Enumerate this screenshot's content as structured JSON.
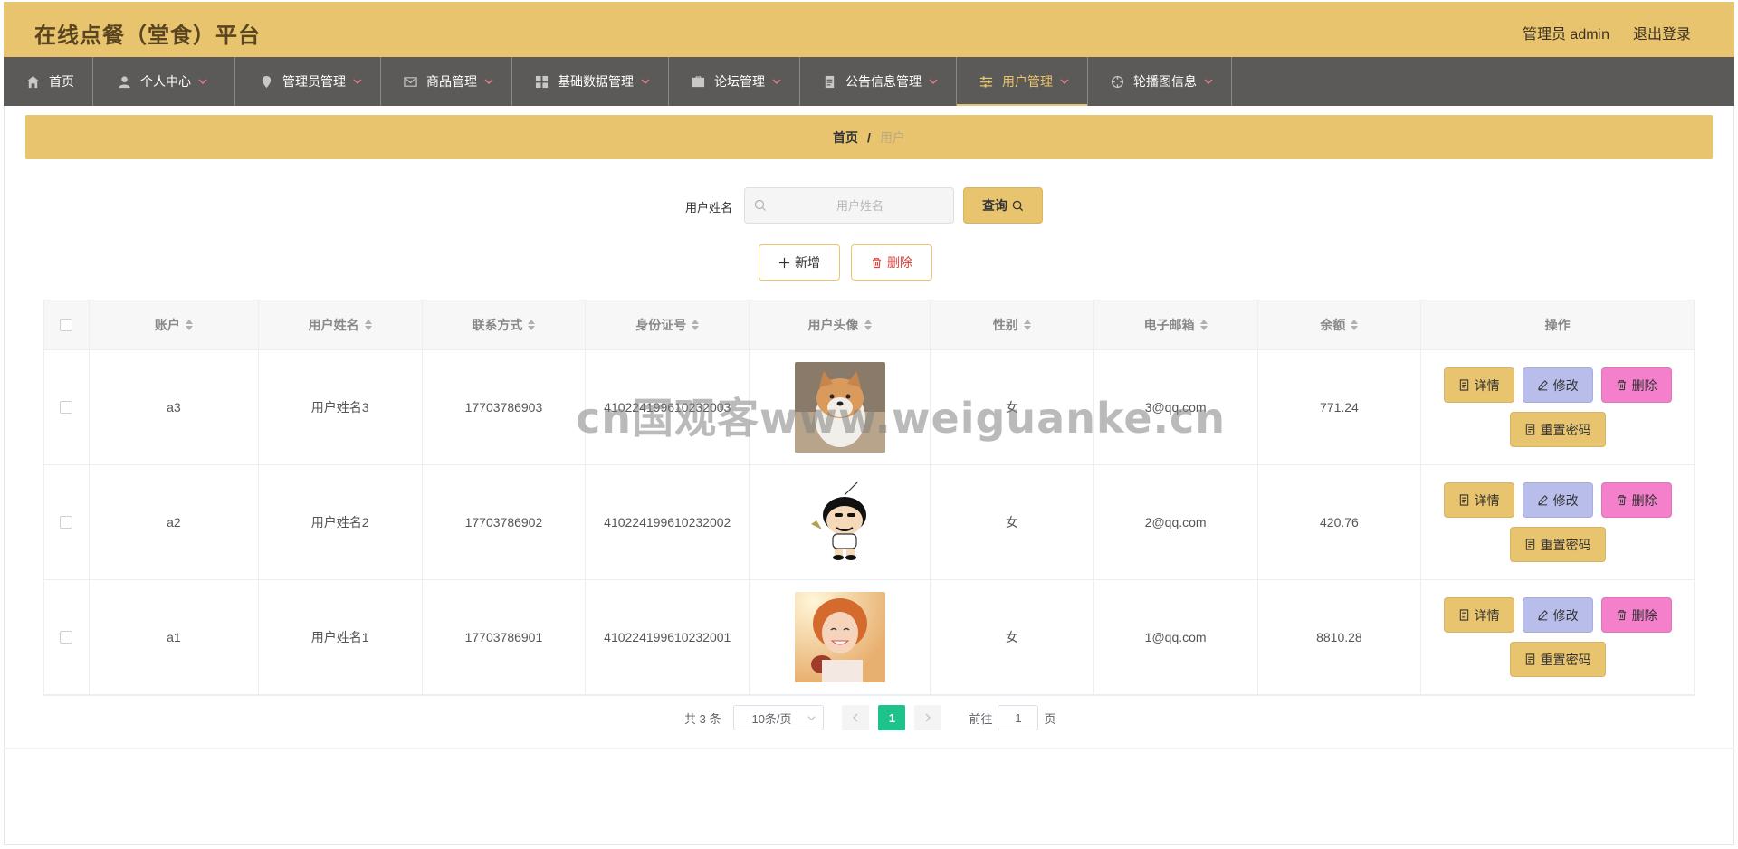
{
  "header": {
    "app_title": "在线点餐（堂食）平台",
    "admin_label": "管理员 admin",
    "logout_label": "退出登录"
  },
  "nav": {
    "items": [
      {
        "label": "首页",
        "icon": "home-icon"
      },
      {
        "label": "个人中心",
        "icon": "user-icon"
      },
      {
        "label": "管理员管理",
        "icon": "location-icon"
      },
      {
        "label": "商品管理",
        "icon": "mail-icon"
      },
      {
        "label": "基础数据管理",
        "icon": "grid-icon"
      },
      {
        "label": "论坛管理",
        "icon": "suitcase-icon"
      },
      {
        "label": "公告信息管理",
        "icon": "document-icon"
      },
      {
        "label": "用户管理",
        "icon": "sliders-icon"
      },
      {
        "label": "轮播图信息",
        "icon": "target-icon"
      }
    ],
    "active_index": 7
  },
  "breadcrumb": {
    "home": "首页",
    "separator": "/",
    "current": "用户"
  },
  "search": {
    "label": "用户姓名",
    "placeholder": "用户姓名",
    "value": "",
    "query_label": "查询"
  },
  "actions": {
    "add_label": "新增",
    "delete_label": "删除"
  },
  "table": {
    "columns": [
      "账户",
      "用户姓名",
      "联系方式",
      "身份证号",
      "用户头像",
      "性别",
      "电子邮箱",
      "余额",
      "操作"
    ],
    "rows": [
      {
        "account": "a3",
        "name": "用户姓名3",
        "phone": "17703786903",
        "id_card": "410224199610232003",
        "avatar": "shiba-dog",
        "gender": "女",
        "email": "3@qq.com",
        "balance": "771.24"
      },
      {
        "account": "a2",
        "name": "用户姓名2",
        "phone": "17703786902",
        "id_card": "410224199610232002",
        "avatar": "cartoon-boy",
        "gender": "女",
        "email": "2@qq.com",
        "balance": "420.76"
      },
      {
        "account": "a1",
        "name": "用户姓名1",
        "phone": "17703786901",
        "id_card": "410224199610232001",
        "avatar": "smiling-girl",
        "gender": "女",
        "email": "1@qq.com",
        "balance": "8810.28"
      }
    ],
    "row_actions": {
      "detail": "详情",
      "edit": "修改",
      "delete": "删除",
      "reset": "重置密码"
    }
  },
  "pagination": {
    "total_text": "共 3 条",
    "page_size": "10条/页",
    "current_page": "1",
    "goto_prefix": "前往",
    "goto_value": "1",
    "goto_suffix": "页"
  },
  "watermark": "cn国观客www.weiguanke.cn",
  "colors": {
    "accent": "#e8c46f",
    "nav_bg": "#5b5a58",
    "edit": "#b8bde9",
    "delete": "#f47fcb",
    "page_active": "#1ec38c"
  }
}
